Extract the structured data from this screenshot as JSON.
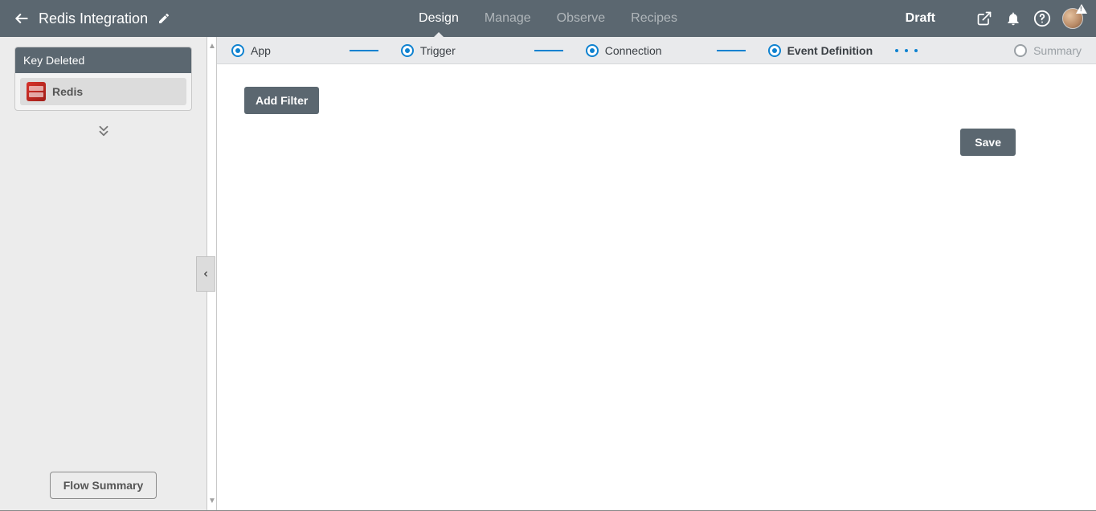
{
  "header": {
    "title": "Redis Integration",
    "status": "Draft",
    "tabs": [
      "Design",
      "Manage",
      "Observe",
      "Recipes"
    ],
    "active_tab_index": 0
  },
  "sidebar": {
    "card_title": "Key Deleted",
    "app": {
      "name": "Redis"
    },
    "flow_summary_label": "Flow Summary"
  },
  "stepbar": {
    "steps": [
      {
        "label": "App",
        "completed": true,
        "current": false
      },
      {
        "label": "Trigger",
        "completed": true,
        "current": false
      },
      {
        "label": "Connection",
        "completed": true,
        "current": false
      },
      {
        "label": "Event Definition",
        "completed": true,
        "current": true
      },
      {
        "label": "Summary",
        "completed": false,
        "current": false
      }
    ]
  },
  "content": {
    "add_filter_label": "Add Filter",
    "save_label": "Save"
  }
}
